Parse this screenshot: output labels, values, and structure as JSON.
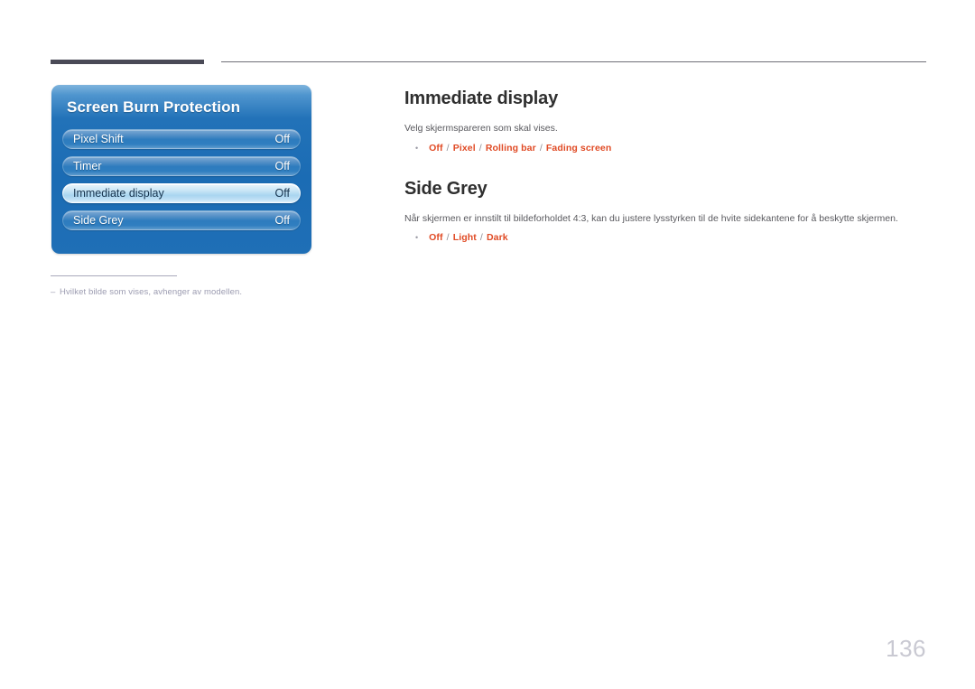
{
  "page": {
    "number": "136"
  },
  "osd": {
    "title": "Screen Burn Protection",
    "rows": [
      {
        "label": "Pixel Shift",
        "value": "Off",
        "selected": false
      },
      {
        "label": "Timer",
        "value": "Off",
        "selected": false
      },
      {
        "label": "Immediate display",
        "value": "Off",
        "selected": true
      },
      {
        "label": "Side Grey",
        "value": "Off",
        "selected": false
      }
    ]
  },
  "footnote": {
    "dash": "–",
    "text": "Hvilket bilde som vises, avhenger av modellen."
  },
  "sections": [
    {
      "heading": "Immediate display",
      "description": "Velg skjermspareren som skal vises.",
      "bullet_marker": "•",
      "options": [
        "Off",
        "Pixel",
        "Rolling bar",
        "Fading screen"
      ],
      "separator": "/"
    },
    {
      "heading": "Side Grey",
      "description": "Når skjermen er innstilt til bildeforholdet 4:3, kan du justere lysstyrken til de hvite sidekantene for å beskytte skjermen.",
      "bullet_marker": "•",
      "options": [
        "Off",
        "Light",
        "Dark"
      ],
      "separator": "/"
    }
  ],
  "colors": {
    "accent_orange": "#e04a24",
    "panel_blue": "#1b6cb4",
    "header_bar": "#4a4a57",
    "page_number": "#c9c9d2"
  }
}
